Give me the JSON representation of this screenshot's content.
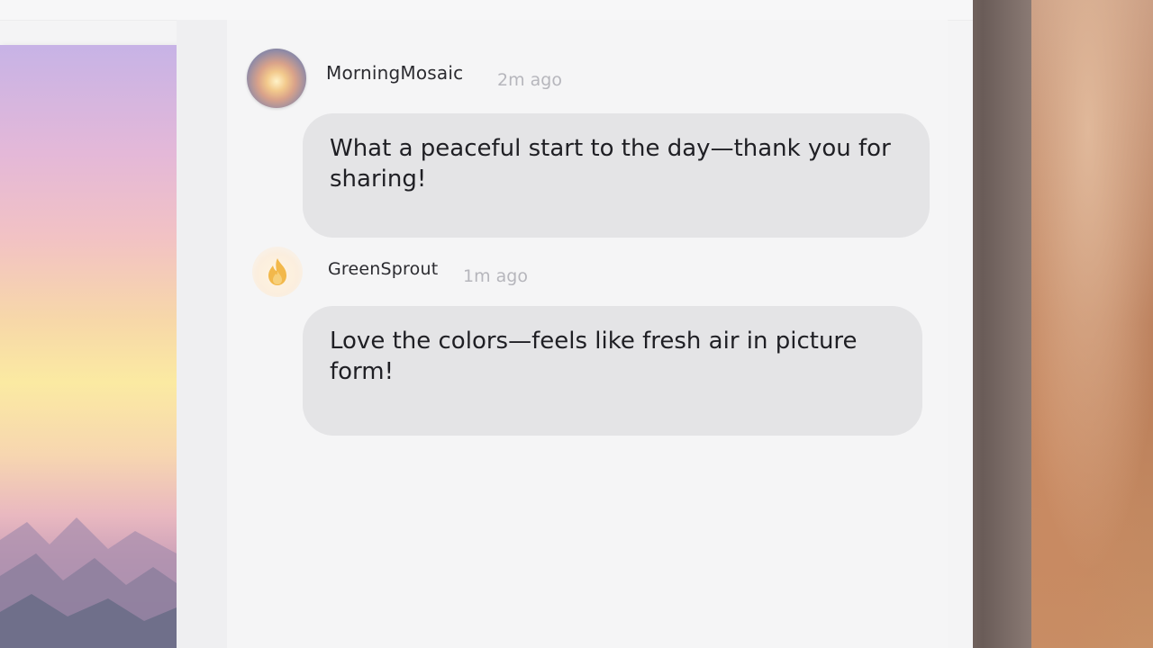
{
  "comments": [
    {
      "username": "MorningMosaic",
      "timestamp": "2m ago",
      "avatar_icon": "sunrise-avatar",
      "text": "What a peaceful start to the day—thank you for sharing!"
    },
    {
      "username": "GreenSprout",
      "timestamp": "1m ago",
      "avatar_icon": "flame-icon",
      "text": "Love the colors—feels like fresh air in picture form!"
    }
  ],
  "colors": {
    "bubble": "#e4e4e6",
    "panel": "#f5f5f6",
    "timestamp": "#b6b6bc",
    "flame": "#f2b84b"
  }
}
